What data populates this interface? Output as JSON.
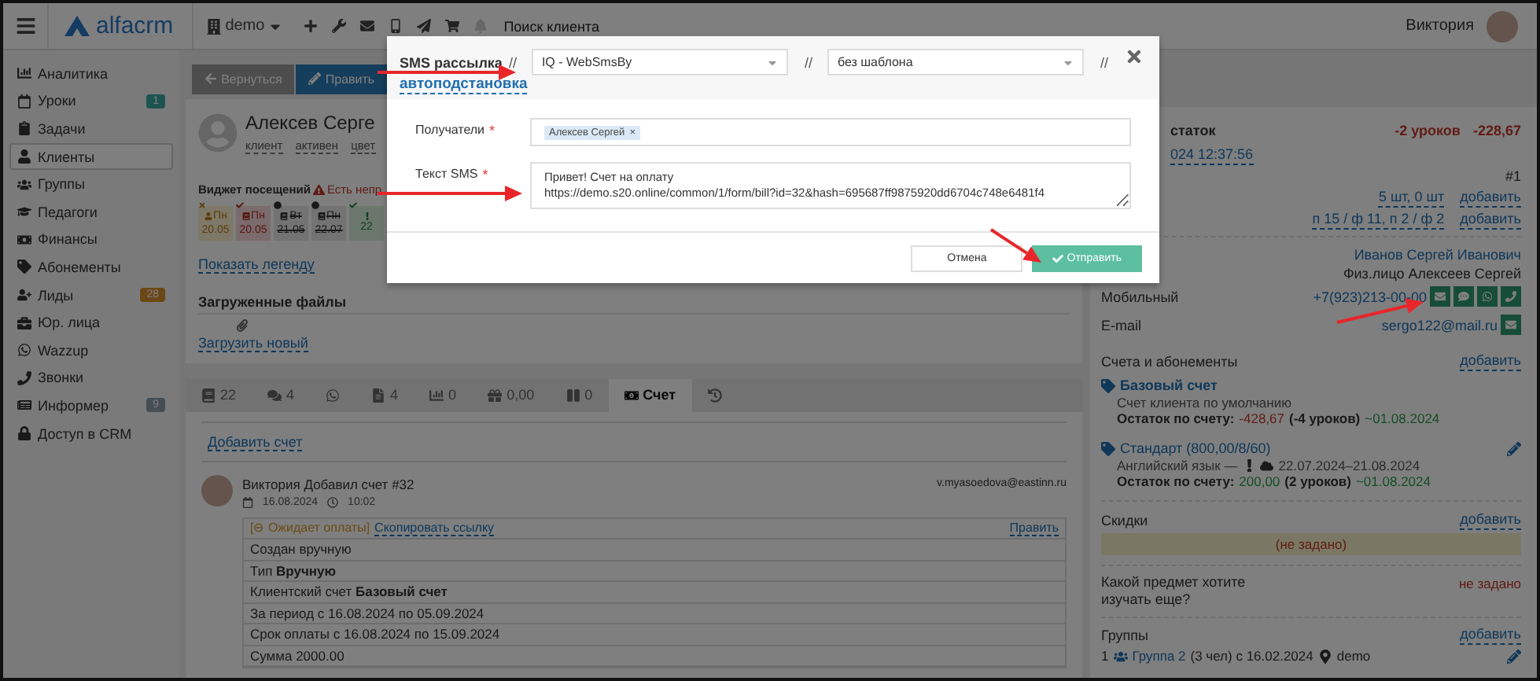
{
  "topbar": {
    "logo": "alfacrm",
    "workspace": "demo",
    "search_placeholder": "Поиск клиента",
    "user": "Виктория"
  },
  "sidebar": {
    "items": [
      {
        "label": "Аналитика",
        "selected": false
      },
      {
        "label": "Уроки",
        "selected": false,
        "badge": "1",
        "color": "#1d5450"
      },
      {
        "label": "Задачи",
        "selected": false
      },
      {
        "label": "Клиенты",
        "selected": true
      },
      {
        "label": "Группы",
        "selected": false
      },
      {
        "label": "Педагоги",
        "selected": false
      },
      {
        "label": "Финансы",
        "selected": false
      },
      {
        "label": "Абонементы",
        "selected": false
      },
      {
        "label": "Лиды",
        "selected": false,
        "badge": "28",
        "color": "#6c4716"
      },
      {
        "label": "Юр. лица",
        "selected": false
      },
      {
        "label": "Wazzup",
        "selected": false
      },
      {
        "label": "Звонки",
        "selected": false
      },
      {
        "label": "Информер",
        "selected": false,
        "badge": "9",
        "color": "#454d55"
      },
      {
        "label": "Доступ в CRM",
        "selected": false
      }
    ]
  },
  "actions": [
    {
      "kind": "back",
      "label": "Вернуться"
    },
    {
      "kind": "edit",
      "label": "Править"
    }
  ],
  "client": {
    "name": "Алексев Серге",
    "tags": [
      "клиент",
      "активен",
      "цвет"
    ]
  },
  "attendance": {
    "title": "Виджет посещений",
    "warning": "Есть непр",
    "days": [
      {
        "kind": "pending",
        "day": "Пн",
        "date": "20.05"
      },
      {
        "kind": "missed",
        "day": "Пн",
        "date": "20.05"
      },
      {
        "kind": "cancelled",
        "day": "Вт",
        "date": "21.05"
      },
      {
        "kind": "cancelled",
        "day": "Пн",
        "date": "22.07"
      },
      {
        "kind": "attended",
        "date": "22"
      }
    ],
    "legend_link": "Показать легенду"
  },
  "files": {
    "title": "Загруженные файлы",
    "upload_link": "Загрузить новый"
  },
  "tabs": [
    {
      "label": "22",
      "selected": false
    },
    {
      "label": "4",
      "selected": false
    },
    {
      "selected": false
    },
    {
      "label": "4",
      "selected": false
    },
    {
      "label": "0",
      "selected": false
    },
    {
      "label": "0,00",
      "selected": false
    },
    {
      "label": "0",
      "selected": false
    },
    {
      "label": "Счет",
      "selected": true
    },
    {
      "selected": false
    }
  ],
  "invoice": {
    "add_link": "Добавить счет",
    "author": "Виктория",
    "action": "Добавил счет #32",
    "date": "16.08.2024",
    "time": "10:02",
    "email": "v.myasoedova@eastinn.ru",
    "status": "[⊖ Ожидает оплаты]",
    "copy_link": "Скопировать ссылку",
    "edit_link": "Править",
    "rows": [
      "Создан вручную",
      "Тип **Вручную**",
      "Клиентский счет **Базовый счет**",
      "За период с 16.08.2024 по 05.09.2024",
      "Срок оплаты с 16.08.2024 по 15.09.2024",
      "Сумма 2000.00"
    ]
  },
  "client_panel": {
    "balance": {
      "label": "статок",
      "lessons": "-2 уроков",
      "amount": "-228,67"
    },
    "updated": "024 12:37:56",
    "number": "#1",
    "counters": [
      {
        "value": "5 шт, 0 шт",
        "action": "добавить"
      },
      {
        "value": "п 15 / ф 11, п 2 / ф 2",
        "action": "добавить"
      }
    ],
    "responsible": "Иванов Сергей Иванович",
    "payer": "Физ.лицо Алексеев Сергей",
    "contacts": [
      {
        "kind": "phone",
        "label": "Мобильный",
        "value": "+7(923)213-00-00"
      },
      {
        "kind": "email",
        "label": "E-mail",
        "value": "sergo122@mail.ru"
      }
    ],
    "accounts": {
      "title": "Счета и абонементы",
      "action": "добавить",
      "items": [
        {
          "kind": "account",
          "name": "Базовый счет",
          "description": "Счет клиента по умолчанию",
          "balance_label": "Остаток по счету:",
          "amount": "-428,67",
          "negative": true,
          "lessons": "(-4 уроков)",
          "until": "~01.08.2024"
        },
        {
          "kind": "subscription",
          "name": "Стандарт (800,00/8/60)",
          "description": "Английский язык —",
          "period": "22.07.2024–21.08.2024",
          "balance_label": "Остаток по счету:",
          "amount": "200,00",
          "negative": false,
          "lessons": "(2 уроков)",
          "until": "~01.08.2024"
        }
      ]
    },
    "discounts": {
      "title": "Скидки",
      "action": "добавить",
      "empty": "(не задано)"
    },
    "custom_field": {
      "label": "Какой предмет хотите изучать еще?",
      "value": "не задано"
    },
    "groups": {
      "title": "Группы",
      "action": "добавить",
      "items": [
        {
          "index": "1",
          "name": "Группа 2",
          "details": "(3 чел) с 16.02.2024",
          "branch": "demo"
        }
      ]
    }
  },
  "modal": {
    "header": [
      {
        "kind": "title",
        "text": "SMS рассылка"
      },
      {
        "kind": "separator",
        "text": "//"
      },
      {
        "kind": "select",
        "text": "IQ - WebSmsBy"
      },
      {
        "kind": "separator",
        "text": "//"
      },
      {
        "kind": "select",
        "text": "без шаблона"
      },
      {
        "kind": "separator",
        "text": "//"
      },
      {
        "kind": "link",
        "text": "автоподстановка"
      }
    ],
    "required_mark": "*",
    "recipients_label": "Получатели",
    "recipients_required": true,
    "recipients": [
      {
        "name": "Алексев Сергей",
        "remove": "×"
      }
    ],
    "text_label": "Текст SMS",
    "text_required": true,
    "text": "Привет! Счет на оплату\nhttps://demo.s20.online/common/1/form/bill?id=32&hash=695687ff9875920dd6704c748e6481f4",
    "buttons": [
      {
        "kind": "secondary",
        "label": "Отмена"
      },
      {
        "kind": "primary",
        "label": "Отправить"
      }
    ]
  }
}
